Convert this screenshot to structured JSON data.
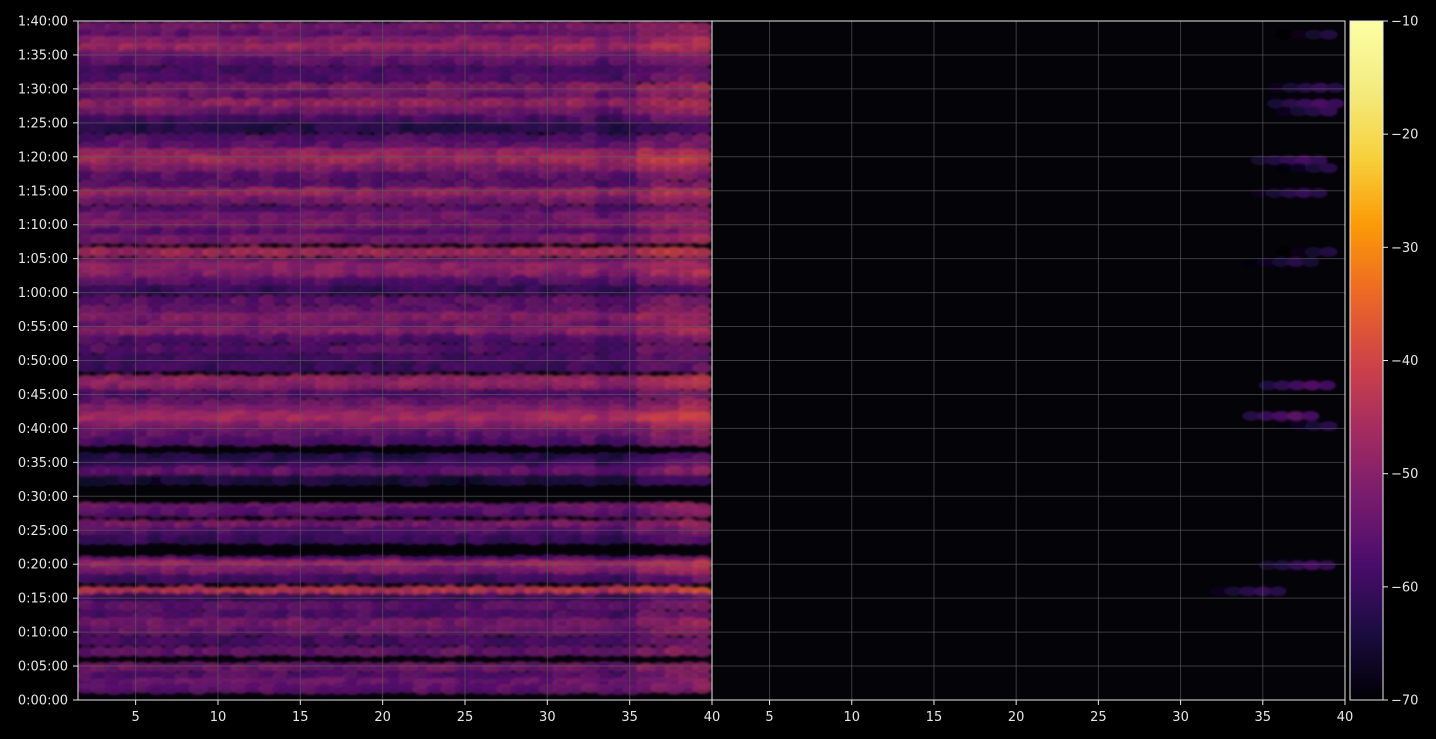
{
  "chart_data": {
    "type": "heatmap",
    "title": "",
    "xlabel": "",
    "ylabel": "",
    "panels": [
      {
        "name": "",
        "xlim": [
          1.5,
          40
        ],
        "x_ticks": [
          5,
          10,
          15,
          20,
          25,
          30,
          35,
          40
        ],
        "x_tick_labels": [
          "5",
          "10",
          "15",
          "20",
          "25",
          "30",
          "35",
          "40"
        ],
        "ylim_seconds": [
          0,
          6000
        ],
        "y_ticks_seconds": [
          0,
          300,
          600,
          900,
          1200,
          1500,
          1800,
          2100,
          2400,
          2700,
          3000,
          3300,
          3600,
          3900,
          4200,
          4500,
          4800,
          5100,
          5400,
          5700,
          6000
        ],
        "y_tick_labels": [
          "0:00:00",
          "0:05:00",
          "0:10:00",
          "0:15:00",
          "0:20:00",
          "0:25:00",
          "0:30:00",
          "0:35:00",
          "0:40:00",
          "0:45:00",
          "0:50:00",
          "0:55:00",
          "1:00:00",
          "1:05:00",
          "1:10:00",
          "1:15:00",
          "1:20:00",
          "1:25:00",
          "1:30:00",
          "1:35:00",
          "1:40:00"
        ],
        "bands": [
          {
            "t": 5950,
            "v": -52
          },
          {
            "t": 5880,
            "v": -54
          },
          {
            "t": 5820,
            "v": -50
          },
          {
            "t": 5760,
            "v": -47
          },
          {
            "t": 5700,
            "v": -52
          },
          {
            "t": 5640,
            "v": -55
          },
          {
            "t": 5560,
            "v": -58
          },
          {
            "t": 5490,
            "v": -57
          },
          {
            "t": 5410,
            "v": -50
          },
          {
            "t": 5345,
            "v": -54
          },
          {
            "t": 5270,
            "v": -48
          },
          {
            "t": 5200,
            "v": -53
          },
          {
            "t": 5130,
            "v": -58
          },
          {
            "t": 5050,
            "v": -62
          },
          {
            "t": 4960,
            "v": -57
          },
          {
            "t": 4890,
            "v": -55
          },
          {
            "t": 4830,
            "v": -48
          },
          {
            "t": 4770,
            "v": -46
          },
          {
            "t": 4700,
            "v": -50
          },
          {
            "t": 4630,
            "v": -55
          },
          {
            "t": 4550,
            "v": -56
          },
          {
            "t": 4480,
            "v": -47
          },
          {
            "t": 4420,
            "v": -52
          },
          {
            "t": 4330,
            "v": -56
          },
          {
            "t": 4270,
            "v": -53
          },
          {
            "t": 4200,
            "v": -51
          },
          {
            "t": 4130,
            "v": -56
          },
          {
            "t": 4070,
            "v": -52
          },
          {
            "t": 3960,
            "v": -46
          },
          {
            "t": 3870,
            "v": -52
          },
          {
            "t": 3820,
            "v": -49
          },
          {
            "t": 3760,
            "v": -50
          },
          {
            "t": 3700,
            "v": -56
          },
          {
            "t": 3620,
            "v": -60
          },
          {
            "t": 3530,
            "v": -55
          },
          {
            "t": 3450,
            "v": -54
          },
          {
            "t": 3380,
            "v": -50
          },
          {
            "t": 3310,
            "v": -53
          },
          {
            "t": 3250,
            "v": -50
          },
          {
            "t": 3190,
            "v": -57
          },
          {
            "t": 3100,
            "v": -56
          },
          {
            "t": 3020,
            "v": -58
          },
          {
            "t": 2940,
            "v": -59
          },
          {
            "t": 2830,
            "v": -48
          },
          {
            "t": 2780,
            "v": -49
          },
          {
            "t": 2700,
            "v": -56
          },
          {
            "t": 2620,
            "v": -53
          },
          {
            "t": 2560,
            "v": -50
          },
          {
            "t": 2510,
            "v": -47
          },
          {
            "t": 2470,
            "v": -46
          },
          {
            "t": 2420,
            "v": -51
          },
          {
            "t": 2350,
            "v": -54
          },
          {
            "t": 2290,
            "v": -57
          },
          {
            "t": 2140,
            "v": -62
          },
          {
            "t": 2080,
            "v": -60
          },
          {
            "t": 2020,
            "v": -54
          },
          {
            "t": 1940,
            "v": -64
          },
          {
            "t": 1700,
            "v": -53
          },
          {
            "t": 1660,
            "v": -56
          },
          {
            "t": 1550,
            "v": -52
          },
          {
            "t": 1490,
            "v": -57
          },
          {
            "t": 1420,
            "v": -60
          },
          {
            "t": 1230,
            "v": -56
          },
          {
            "t": 1190,
            "v": -47
          },
          {
            "t": 1140,
            "v": -52
          },
          {
            "t": 1070,
            "v": -59
          },
          {
            "t": 960,
            "v": -43
          },
          {
            "t": 900,
            "v": -60
          },
          {
            "t": 830,
            "v": -55
          },
          {
            "t": 750,
            "v": -57
          },
          {
            "t": 680,
            "v": -52
          },
          {
            "t": 610,
            "v": -54
          },
          {
            "t": 520,
            "v": -58
          },
          {
            "t": 430,
            "v": -54
          },
          {
            "t": 290,
            "v": -53
          },
          {
            "t": 210,
            "v": -56
          },
          {
            "t": 150,
            "v": -54
          },
          {
            "t": 100,
            "v": -55
          }
        ]
      },
      {
        "name": "",
        "xlim": [
          1.5,
          40
        ],
        "x_ticks": [
          5,
          10,
          15,
          20,
          25,
          30,
          35,
          40
        ],
        "x_tick_labels": [
          "5",
          "10",
          "15",
          "20",
          "25",
          "30",
          "35",
          "40"
        ],
        "background_value": -69,
        "spots": [
          {
            "t": 5880,
            "x": 39,
            "v": -63
          },
          {
            "t": 5410,
            "x": 38.5,
            "v": -60
          },
          {
            "t": 5270,
            "x": 38.5,
            "v": -57
          },
          {
            "t": 5200,
            "x": 39,
            "v": -60
          },
          {
            "t": 4770,
            "x": 37.5,
            "v": -58
          },
          {
            "t": 4700,
            "x": 39,
            "v": -62
          },
          {
            "t": 4480,
            "x": 37.5,
            "v": -60
          },
          {
            "t": 3960,
            "x": 39,
            "v": -63
          },
          {
            "t": 3870,
            "x": 37,
            "v": -62
          },
          {
            "t": 2780,
            "x": 38,
            "v": -56
          },
          {
            "t": 2510,
            "x": 37,
            "v": -55
          },
          {
            "t": 2420,
            "x": 39,
            "v": -62
          },
          {
            "t": 1190,
            "x": 38,
            "v": -58
          },
          {
            "t": 960,
            "x": 35,
            "v": -60
          }
        ]
      }
    ],
    "colorbar": {
      "colormap": "inferno",
      "range": [
        -70,
        -10
      ],
      "ticks": [
        "-10",
        "-20",
        "-30",
        "-40",
        "-50",
        "-60",
        "-70"
      ]
    },
    "grid": true,
    "colors": {
      "background": "#000000",
      "plot_area": "#040308",
      "grid": "#5a5a5a",
      "axis": "#e8e8e8",
      "text": "#e8e8e8"
    }
  }
}
